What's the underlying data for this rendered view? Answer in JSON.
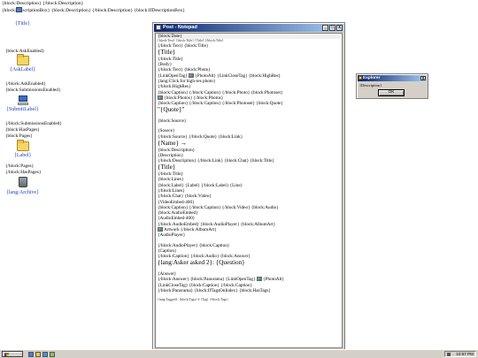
{
  "desktop": {
    "top_line1": "{block:Description} {/block:Description}",
    "top_line2_pre": "{block:",
    "top_line2_post": "scriptionBox} {block:Description} {/block:Description} {block:IfDescriptionBox}",
    "title_label": "{Title}",
    "ask_enabled": "{block:AskEnabled}",
    "ask_label": "{AskLabel}",
    "ask_end": "{/block:AskEnabled}",
    "submissions_enabled": "{block:SubmissionsEnabled}",
    "submit_label": "{SubmitLabel}",
    "submissions_end": "{/block:SubmissionsEnabled}",
    "has_pages": "{block:HasPages}",
    "pages": "{block:Pages}",
    "label": "{Label}",
    "pages_end": "{/block:Pages}",
    "has_pages_end": "{/block:HasPages}",
    "archive": "{lang:Archive}"
  },
  "notepad": {
    "title": "Post - Notepad",
    "minimize": "_",
    "maximize": "□",
    "close": "x",
    "lines": [
      {
        "t": "{block:Date}",
        "k": "sel"
      },
      {
        "t": "{block:Text} {block:Title} {Title} {/block:Title}",
        "k": "tiny"
      },
      {
        "t": "{/block:Text} {block:Title}",
        "k": ""
      },
      {
        "t": "{Title}",
        "k": "big"
      },
      {
        "t": "{/block:Title}",
        "k": ""
      },
      {
        "t": "{Body}",
        "k": ""
      },
      {
        "t": "{/block:Text} {block:Photo}",
        "k": ""
      },
      {
        "t": "{LinkOpenTag}  [photo] {PhotoAlt}  {LinkCloseTag}  {block:HighRes}",
        "k": "photo"
      },
      {
        "t": "{lang:Click for high-res photo}",
        "k": ""
      },
      {
        "t": "{/block:HighRes}",
        "k": ""
      },
      {
        "t": "{block:Caption}  {/block:Caption}  {/block:Photo}  {block:Photoset}",
        "k": ""
      },
      {
        "t": "[photo] {block:Photos}  {/block:Photos}",
        "k": "photo"
      },
      {
        "t": "{block:Caption}  {/block:Caption}  {/block:Photoset}  {block:Quote}",
        "k": ""
      },
      {
        "t": "\"{Quote}\"",
        "k": "big"
      },
      {
        "t": "",
        "k": "gap"
      },
      {
        "t": "{block:Source}",
        "k": ""
      },
      {
        "t": "",
        "k": "gap"
      },
      {
        "t": "{Source}",
        "k": ""
      },
      {
        "t": "{/block:Source}  {/block:Quote}  {block:Link}",
        "k": ""
      },
      {
        "t": "{Name} →",
        "k": "big"
      },
      {
        "t": "{block:Description}",
        "k": ""
      },
      {
        "t": "{Description}",
        "k": ""
      },
      {
        "t": "{/block:Description}  {/block:Link}  {block:Chat}  {block:Title}",
        "k": ""
      },
      {
        "t": "{Title}",
        "k": "big"
      },
      {
        "t": "{/block:Title}",
        "k": ""
      },
      {
        "t": "{block:Lines}",
        "k": ""
      },
      {
        "t": "{block:Label}  {Label}  {/block:Label}  {Line}",
        "k": ""
      },
      {
        "t": "{/block:Lines}",
        "k": ""
      },
      {
        "t": "{/block:Chat}  {block:Video}",
        "k": ""
      },
      {
        "t": "{VideoEmbed-400}",
        "k": ""
      },
      {
        "t": "{block:Caption}  {/block:Caption}  {/block:Video}  {block:Audio}",
        "k": ""
      },
      {
        "t": "{block:AudioEmbed}",
        "k": ""
      },
      {
        "t": "{AudioEmbed-400}",
        "k": ""
      },
      {
        "t": "{/block:AudioEmbed}  {block:AudioPlayer}  {block:AlbumArt}",
        "k": ""
      },
      {
        "t": "[photo] Artwork  {/block:AlbumArt}",
        "k": "photo"
      },
      {
        "t": "{AudioPlayer}",
        "k": ""
      },
      {
        "t": "",
        "k": "gap"
      },
      {
        "t": "{/block:AudioPlayer}  {block:Caption}",
        "k": ""
      },
      {
        "t": "{Caption}",
        "k": ""
      },
      {
        "t": "{/block:Caption}  {/block:Audio}  {block:Answer}",
        "k": ""
      },
      {
        "t": "{lang:Asker asked 2}: {Question}",
        "k": "big"
      },
      {
        "t": "",
        "k": "gap"
      },
      {
        "t": "{Answer}",
        "k": ""
      },
      {
        "t": "{/block:Answer}  {block:Panorama}  {LinkOpenTag}  [photo] {PhotoAlt}",
        "k": "photo"
      },
      {
        "t": "{LinkCloseTag}  {block:Caption}  {/block:Caption}",
        "k": ""
      },
      {
        "t": "{/block:Panorama}  {block:IfTagsOnIndex}  {block:HasTags}",
        "k": ""
      },
      {
        "t": "",
        "k": "gap"
      },
      {
        "t": "{lang:Tagged}: {block:Tags} # {Tag} {/block:Tags}",
        "k": "tiny"
      }
    ]
  },
  "explorer": {
    "title": "Explorer",
    "close": "x",
    "description": "{Description}",
    "ok_label": "OK"
  },
  "taskbar": {
    "clock": "10:57 PM"
  }
}
